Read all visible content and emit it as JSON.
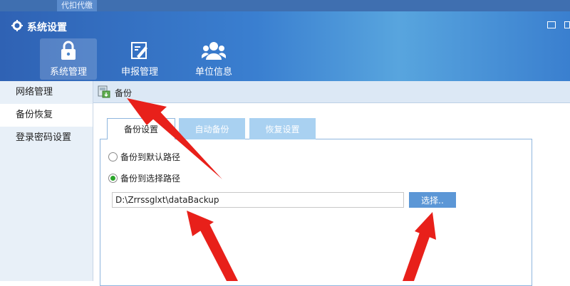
{
  "top_tab": "代扣代缴",
  "window": {
    "title": "系统设置"
  },
  "nav": [
    {
      "label": "系统管理",
      "icon": "lock-icon"
    },
    {
      "label": "申报管理",
      "icon": "edit-icon"
    },
    {
      "label": "单位信息",
      "icon": "users-icon"
    }
  ],
  "sidebar": {
    "items": [
      {
        "label": "网络管理"
      },
      {
        "label": "备份恢复"
      },
      {
        "label": "登录密码设置"
      }
    ]
  },
  "toolbar": {
    "backup_label": "备份"
  },
  "tabs": [
    {
      "label": "备份设置"
    },
    {
      "label": "自动备份"
    },
    {
      "label": "恢复设置"
    }
  ],
  "backup": {
    "radio_default": "备份到默认路径",
    "radio_choose": "备份到选择路径",
    "path_value": "D:\\Zrrssglxt\\dataBackup",
    "choose_button": "选择.."
  },
  "colors": {
    "header": "#3a7fd0",
    "accent": "#5c97d6",
    "annotation_arrow": "#e8201a"
  }
}
